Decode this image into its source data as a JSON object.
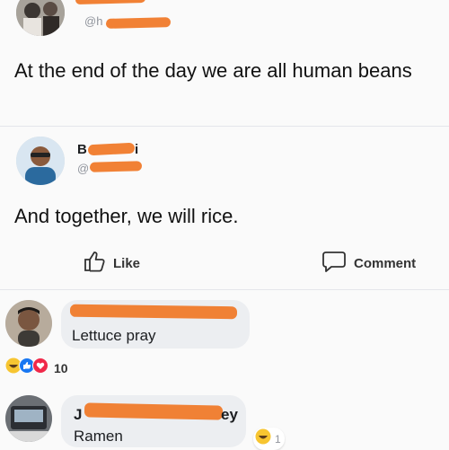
{
  "post1": {
    "handle": "@h",
    "text": "At the end of the day we are all human beans"
  },
  "post2": {
    "author": "B",
    "author_tail": "i",
    "handle": "@",
    "text": "And together, we will rice."
  },
  "actions": {
    "like_label": "Like",
    "comment_label": "Comment"
  },
  "comment1": {
    "text": "Lettuce pray",
    "reaction_count": "10"
  },
  "comment2": {
    "author_start": "J",
    "author_end": "ey",
    "text": "Ramen",
    "reaction_count": "1"
  },
  "colors": {
    "redaction": "#f07a2a",
    "reaction_blue": "#1877f2",
    "reaction_red": "#f02849",
    "reaction_yellow": "#f7c531"
  }
}
